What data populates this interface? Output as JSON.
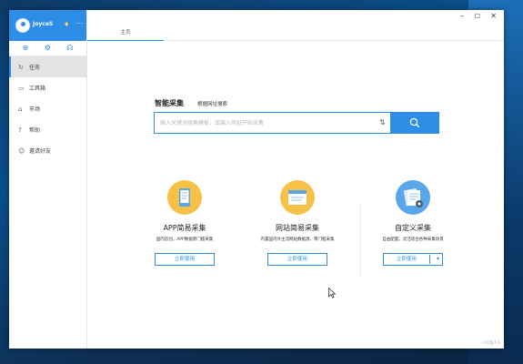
{
  "sidebar": {
    "user_name": "JoyceS",
    "tools": [
      "add-circle-icon",
      "gear-icon",
      "headset-icon"
    ],
    "items": [
      {
        "label": "任务",
        "icon": "refresh-icon",
        "active": true
      },
      {
        "label": "工具箱",
        "icon": "toolbox-icon",
        "active": false
      },
      {
        "label": "市场",
        "icon": "home-icon",
        "active": false
      },
      {
        "label": "帮助",
        "icon": "help-icon",
        "active": false
      },
      {
        "label": "邀请好友",
        "icon": "friends-icon",
        "active": false
      }
    ]
  },
  "topbar": {
    "tab_home": "主页"
  },
  "search": {
    "smart_tab": "智能采集",
    "web_tab": "根据网址搜索",
    "placeholder": "输入关键词搜索模板，或输入网址开始采集"
  },
  "cards": [
    {
      "title": "APP简易采集",
      "desc": "国内首创，APP数据爬门槛采集",
      "button": "立即使用",
      "icon_color": "#f7c148"
    },
    {
      "title": "网站简易采集",
      "desc": "内置国内外主流网站数据源，零门槛采集",
      "button": "立即使用",
      "icon_color": "#f7c148"
    },
    {
      "title": "自定义采集",
      "desc": "自由配置，灵活适合各种采集场景",
      "button": "立即使用",
      "icon_color": "#5aa6ea"
    }
  ],
  "version": "八爪鱼7.6",
  "colors": {
    "accent": "#2e8de6",
    "sidebar_active": "#e3e3e3"
  }
}
